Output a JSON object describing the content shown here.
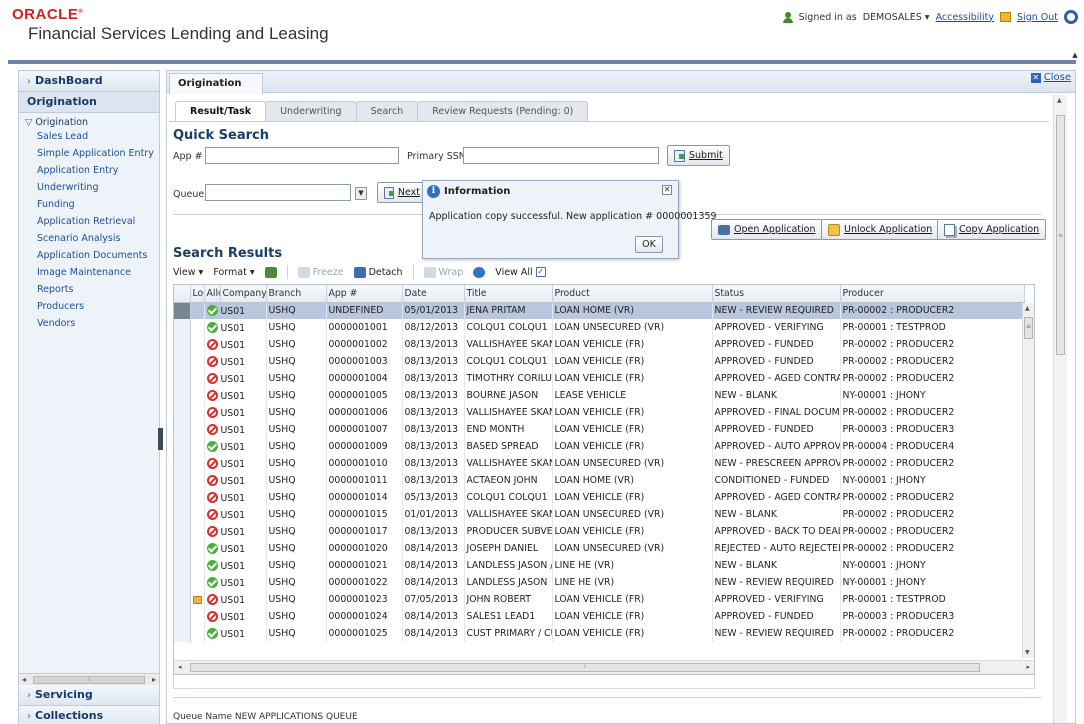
{
  "header": {
    "brand": "ORACLE",
    "brand_mark": "®",
    "app_title": "Financial Services Lending and Leasing",
    "signed_in_label": "Signed in as",
    "username": "DEMOSALES",
    "username_caret": "▾",
    "accessibility": "Accessibility",
    "sign_out": "Sign Out"
  },
  "sidebar": {
    "dashboard": "DashBoard",
    "section": "Origination",
    "tree_root": "Origination",
    "items": [
      "Sales Lead",
      "Simple Application Entry",
      "Application Entry",
      "Underwriting",
      "Funding",
      "Application Retrieval",
      "Scenario Analysis",
      "Application Documents",
      "Image Maintenance",
      "Reports",
      "Producers",
      "Vendors"
    ],
    "servicing": "Servicing",
    "collections": "Collections"
  },
  "main": {
    "tab": "Origination",
    "close": "Close",
    "subtabs": [
      "Result/Task",
      "Underwriting",
      "Search",
      "Review Requests (Pending: 0)"
    ],
    "quick_search": {
      "title": "Quick Search",
      "app_label": "App #",
      "ssn_label": "Primary SSN",
      "submit": "Submit",
      "queue_label": "Queue",
      "next_button": "Next"
    },
    "actions": {
      "open": "Open Application",
      "unlock": "Unlock Application",
      "copy": "Copy Application"
    },
    "search_results": {
      "title": "Search Results",
      "toolbar": {
        "view": "View",
        "format": "Format",
        "freeze": "Freeze",
        "detach": "Detach",
        "wrap": "Wrap",
        "view_all": "View All",
        "dropdown_caret": "▾",
        "view_all_checked": "✓"
      },
      "columns": [
        "Lock",
        "Allo",
        "Company",
        "Branch",
        "App #",
        "Date",
        "Title",
        "Product",
        "Status",
        "Producer"
      ],
      "rows": [
        {
          "lock": false,
          "allow": "ok",
          "company": "US01",
          "branch": "USHQ",
          "app": "UNDEFINED",
          "date": "05/01/2013",
          "title": "JENA PRITAM",
          "product": "LOAN HOME (VR)",
          "status": "NEW - REVIEW REQUIRED",
          "producer": "PR-00002 : PRODUCER2"
        },
        {
          "lock": false,
          "allow": "ok",
          "company": "US01",
          "branch": "USHQ",
          "app": "0000001001",
          "date": "08/12/2013",
          "title": "COLQU1 COLQU1",
          "product": "LOAN UNSECURED (VR)",
          "status": "APPROVED - VERIFYING",
          "producer": "PR-00001 : TESTPROD"
        },
        {
          "lock": false,
          "allow": "no",
          "company": "US01",
          "branch": "USHQ",
          "app": "0000001002",
          "date": "08/13/2013",
          "title": "VALLISHAYEE SKAND.",
          "product": "LOAN VEHICLE (FR)",
          "status": "APPROVED - FUNDED",
          "producer": "PR-00002 : PRODUCER2"
        },
        {
          "lock": false,
          "allow": "no",
          "company": "US01",
          "branch": "USHQ",
          "app": "0000001003",
          "date": "08/13/2013",
          "title": "COLQU1 COLQU1",
          "product": "LOAN VEHICLE (FR)",
          "status": "APPROVED - FUNDED",
          "producer": "PR-00002 : PRODUCER2"
        },
        {
          "lock": false,
          "allow": "no",
          "company": "US01",
          "branch": "USHQ",
          "app": "0000001004",
          "date": "08/13/2013",
          "title": "TIMOTHRY CORILUS",
          "product": "LOAN VEHICLE (FR)",
          "status": "APPROVED - AGED CONTRACT",
          "producer": "PR-00002 : PRODUCER2"
        },
        {
          "lock": false,
          "allow": "no",
          "company": "US01",
          "branch": "USHQ",
          "app": "0000001005",
          "date": "08/13/2013",
          "title": "BOURNE JASON",
          "product": "LEASE VEHICLE",
          "status": "NEW - BLANK",
          "producer": "NY-00001 : JHONY"
        },
        {
          "lock": false,
          "allow": "no",
          "company": "US01",
          "branch": "USHQ",
          "app": "0000001006",
          "date": "08/13/2013",
          "title": "VALLISHAYEE SKAND.",
          "product": "LOAN VEHICLE (FR)",
          "status": "APPROVED - FINAL DOCUMENT",
          "producer": "PR-00002 : PRODUCER2"
        },
        {
          "lock": false,
          "allow": "no",
          "company": "US01",
          "branch": "USHQ",
          "app": "0000001007",
          "date": "08/13/2013",
          "title": "END MONTH",
          "product": "LOAN VEHICLE (FR)",
          "status": "APPROVED - FUNDED",
          "producer": "PR-00003 : PRODUCER3"
        },
        {
          "lock": false,
          "allow": "ok",
          "company": "US01",
          "branch": "USHQ",
          "app": "0000001009",
          "date": "08/13/2013",
          "title": "BASED SPREAD",
          "product": "LOAN VEHICLE (FR)",
          "status": "APPROVED - AUTO APPROVED",
          "producer": "PR-00004 : PRODUCER4"
        },
        {
          "lock": false,
          "allow": "no",
          "company": "US01",
          "branch": "USHQ",
          "app": "0000001010",
          "date": "08/13/2013",
          "title": "VALLISHAYEE SKAND.",
          "product": "LOAN UNSECURED (VR)",
          "status": "NEW - PRESCREEN APPROVED",
          "producer": "PR-00002 : PRODUCER2"
        },
        {
          "lock": false,
          "allow": "no",
          "company": "US01",
          "branch": "USHQ",
          "app": "0000001011",
          "date": "08/13/2013",
          "title": "ACTAEON JOHN",
          "product": "LOAN HOME (VR)",
          "status": "CONDITIONED - FUNDED",
          "producer": "NY-00001 : JHONY"
        },
        {
          "lock": false,
          "allow": "no",
          "company": "US01",
          "branch": "USHQ",
          "app": "0000001014",
          "date": "05/13/2013",
          "title": "COLQU1 COLQU1",
          "product": "LOAN VEHICLE (FR)",
          "status": "APPROVED - AGED CONTRACT",
          "producer": "PR-00002 : PRODUCER2"
        },
        {
          "lock": false,
          "allow": "no",
          "company": "US01",
          "branch": "USHQ",
          "app": "0000001015",
          "date": "01/01/2013",
          "title": "VALLISHAYEE SKAND.",
          "product": "LOAN UNSECURED (VR)",
          "status": "NEW - BLANK",
          "producer": "PR-00002 : PRODUCER2"
        },
        {
          "lock": false,
          "allow": "no",
          "company": "US01",
          "branch": "USHQ",
          "app": "0000001017",
          "date": "08/13/2013",
          "title": "PRODUCER SUBVENT",
          "product": "LOAN VEHICLE (FR)",
          "status": "APPROVED - BACK TO DEALER",
          "producer": "PR-00002 : PRODUCER2"
        },
        {
          "lock": false,
          "allow": "ok",
          "company": "US01",
          "branch": "USHQ",
          "app": "0000001020",
          "date": "08/14/2013",
          "title": "JOSEPH DANIEL",
          "product": "LOAN UNSECURED (VR)",
          "status": "REJECTED - AUTO REJECTED",
          "producer": "PR-00002 : PRODUCER2"
        },
        {
          "lock": false,
          "allow": "ok",
          "company": "US01",
          "branch": "USHQ",
          "app": "0000001021",
          "date": "08/14/2013",
          "title": "LANDLESS JASON / J/",
          "product": "LINE HE (VR)",
          "status": "NEW - BLANK",
          "producer": "NY-00001 : JHONY"
        },
        {
          "lock": false,
          "allow": "ok",
          "company": "US01",
          "branch": "USHQ",
          "app": "0000001022",
          "date": "08/14/2013",
          "title": "LANDLESS JASON",
          "product": "LINE HE (VR)",
          "status": "NEW - REVIEW REQUIRED",
          "producer": "NY-00001 : JHONY"
        },
        {
          "lock": true,
          "allow": "no",
          "company": "US01",
          "branch": "USHQ",
          "app": "0000001023",
          "date": "07/05/2013",
          "title": "JOHN ROBERT",
          "product": "LOAN VEHICLE (FR)",
          "status": "APPROVED - VERIFYING",
          "producer": "PR-00001 : TESTPROD"
        },
        {
          "lock": false,
          "allow": "no",
          "company": "US01",
          "branch": "USHQ",
          "app": "0000001024",
          "date": "08/14/2013",
          "title": "SALES1 LEAD1",
          "product": "LOAN VEHICLE (FR)",
          "status": "APPROVED - FUNDED",
          "producer": "PR-00003 : PRODUCER3"
        },
        {
          "lock": false,
          "allow": "ok",
          "company": "US01",
          "branch": "USHQ",
          "app": "0000001025",
          "date": "08/14/2013",
          "title": "CUST PRIMARY / CUS",
          "product": "LOAN VEHICLE (FR)",
          "status": "NEW - REVIEW REQUIRED",
          "producer": "PR-00002 : PRODUCER2"
        }
      ]
    },
    "queue_name_label": "Queue Name",
    "queue_name_value": "NEW APPLICATIONS QUEUE"
  },
  "dialog": {
    "title": "Information",
    "message": "Application copy successful. New application # 0000001359",
    "ok": "OK"
  },
  "glyphs": {
    "chevron_right": "›",
    "tree_open": "▽",
    "collapse_left": "◂",
    "scroll_up": "▲",
    "scroll_down": "▼",
    "scroll_left": "◂",
    "scroll_right": "▸",
    "close_x": "✕",
    "grip": "≡",
    "grip_h": "⁞",
    "combo_arrow": "▼"
  },
  "colors": {
    "brand_red": "#d2231b",
    "link_blue": "#1f4e99",
    "heading_navy": "#1a3d6b",
    "selected_row": "#b8c7dd",
    "ok_green": "#4caf3c",
    "deny_red": "#d8302a"
  }
}
